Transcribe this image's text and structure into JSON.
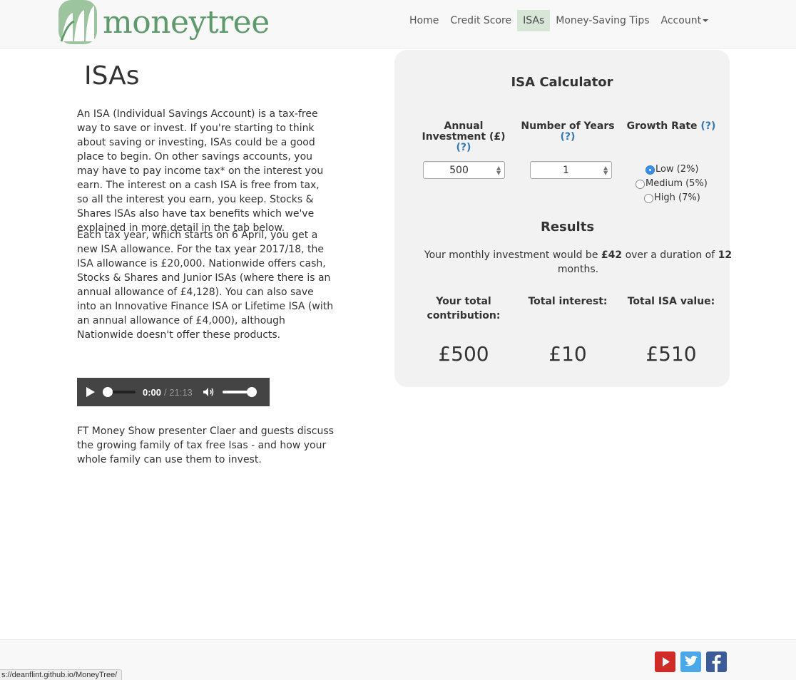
{
  "brand": {
    "name": "moneytree",
    "logo_icon": "tree-chart-logo"
  },
  "nav": {
    "items": [
      {
        "label": "Home"
      },
      {
        "label": "Credit Score"
      },
      {
        "label": "ISAs"
      },
      {
        "label": "Money-Saving Tips"
      },
      {
        "label": "Account"
      }
    ],
    "active": "ISAs"
  },
  "main": {
    "title": "ISAs",
    "paragraphs": [
      "An ISA (Individual Savings Account) is a tax-free way to save or invest. If you're starting to think about saving or investing, ISAs could be a good place to begin. On other savings accounts, you may have to pay income tax* on the interest you earn. The interest on a cash ISA is free from tax, so all the interest you earn, you keep. Stocks & Shares ISAs also have tax benefits which we've explained in more detail in the tab below.",
      "Each tax year, which starts on 6 April, you get a new ISA allowance. For the tax year 2017/18, the ISA allowance is £20,000. Nationwide offers cash, Stocks & Shares and Junior ISAs (where there is an annual allowance of £4,128). You can also save into an Innovative Finance ISA or Lifetime ISA (with an annual allowance of £4,000), although Nationwide doesn't offer these products.",
      "FT Money Show presenter Claer and guests discuss the growing family of tax free Isas - and how your whole family can use them to invest."
    ],
    "audio": {
      "current_time": "0:00",
      "duration": "/ 21:13",
      "progress": 0,
      "volume": 1
    }
  },
  "calculator": {
    "title": "ISA Calculator",
    "help_label": "(?)",
    "annual_investment": {
      "label": "Annual Investment (£)",
      "value": "500"
    },
    "years": {
      "label": "Number of Years",
      "value": "1"
    },
    "growth_rate": {
      "label": "Growth Rate",
      "options": [
        "Low (2%)",
        "Medium (5%)",
        "High (7%)"
      ],
      "selected": "Low (2%)"
    },
    "results": {
      "title": "Results",
      "summary_prefix": "Your monthly investment would be ",
      "monthly": "£42",
      "summary_middle": " over a duration of ",
      "duration": "12",
      "summary_suffix": " months.",
      "contribution_label": "Your total contribution:",
      "interest_label": "Total interest:",
      "value_label": "Total ISA value:",
      "contribution": "£500",
      "interest": "£10",
      "total": "£510"
    }
  },
  "footer": {
    "social": [
      "youtube-icon",
      "twitter-icon",
      "facebook-icon"
    ]
  },
  "status_bar": {
    "url": "s://deanflint.github.io/MoneyTree/"
  },
  "colors": {
    "brand_green": "#5e9a6b",
    "active_nav_bg": "#d8e6d8",
    "link_blue": "#337ab7",
    "calc_bg": "#f2f2f2"
  }
}
